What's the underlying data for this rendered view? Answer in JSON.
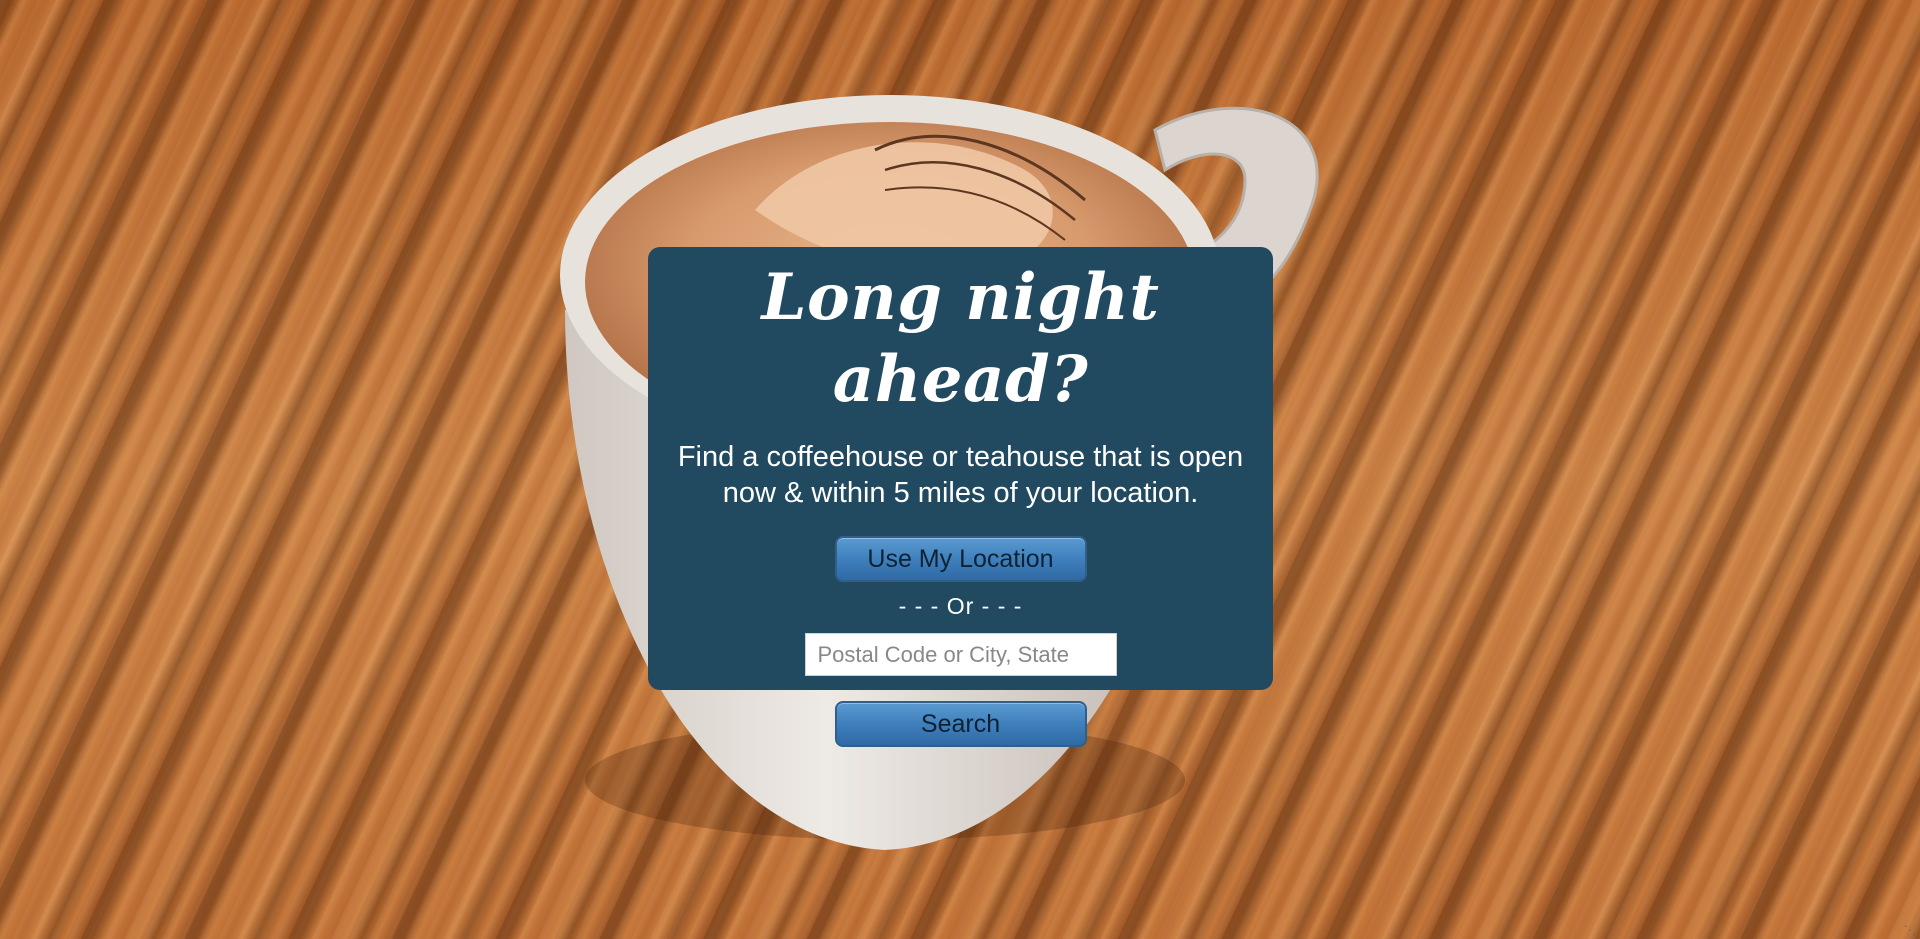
{
  "panel": {
    "headline": "Long night ahead?",
    "subtext_line1": "Find a coffeehouse or teahouse that is open",
    "subtext_line2": "now & within 5 miles of your location.",
    "location_button_label": "Use My Location",
    "or_separator": "- - - Or - - -",
    "search_input": {
      "placeholder": "Postal Code or City, State",
      "value": ""
    },
    "search_button_label": "Search"
  },
  "colors": {
    "panel_background": "#214a60",
    "button_blue": "#3f80bd",
    "text_white": "#ffffff"
  },
  "background": {
    "image_subject": "latte art coffee cup on wood table"
  }
}
